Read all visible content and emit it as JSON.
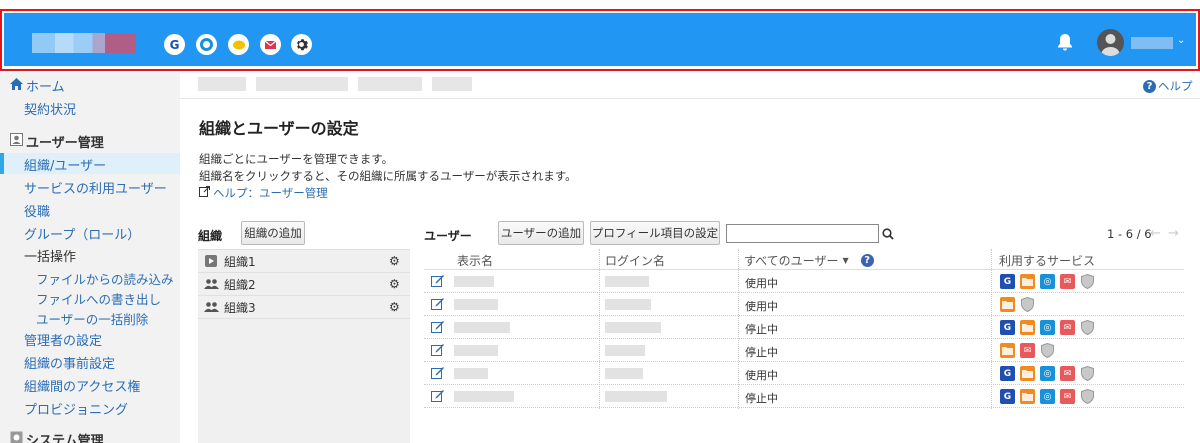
{
  "header": {
    "service_icons": [
      {
        "name": "g-service-icon",
        "glyph": "G",
        "color": "#1f4fb0"
      },
      {
        "name": "circle-service-icon",
        "glyph": "◎",
        "color": "#1891d9"
      },
      {
        "name": "chat-service-icon",
        "glyph": "●",
        "color": "#f2c200"
      },
      {
        "name": "mail-service-icon",
        "glyph": "✉",
        "color": "#e0364d"
      },
      {
        "name": "settings-gear-icon",
        "glyph": "⚙",
        "color": "#333333"
      }
    ],
    "caret": "⌄"
  },
  "sidebar": {
    "home": "ホーム",
    "contract": "契約状況",
    "user_mgmt": "ユーザー管理",
    "items": [
      "組織/ユーザー",
      "サービスの利用ユーザー",
      "役職",
      "グループ（ロール）"
    ],
    "bulk": "一括操作",
    "bulk_items": [
      "ファイルからの読み込み",
      "ファイルへの書き出し",
      "ユーザーの一括削除"
    ],
    "more": [
      "管理者の設定",
      "組織の事前設定",
      "組織間のアクセス権",
      "プロビジョニング"
    ],
    "system_mgmt": "システム管理"
  },
  "main": {
    "help": "ヘルプ",
    "title": "組織とユーザーの設定",
    "desc1": "組織ごとにユーザーを管理できます。",
    "desc2": "組織名をクリックすると、その組織に所属するユーザーが表示されます。",
    "help_link": "ヘルプ：ユーザー管理",
    "org_label": "組織",
    "add_org": "組織の追加",
    "orgs": [
      "組織1",
      "組織2",
      "組織3"
    ],
    "user_label": "ユーザー",
    "add_user": "ユーザーの追加",
    "profile_settings": "プロフィール項目の設定",
    "search_value": "",
    "pager": "1 - 6 / 6",
    "columns": {
      "display_name": "表示名",
      "login_name": "ログイン名",
      "all_users": "すべてのユーザー",
      "services": "利用するサービス"
    },
    "rows": [
      {
        "status": "使用中",
        "services": [
          "G",
          "F",
          "O",
          "M",
          "S"
        ]
      },
      {
        "status": "使用中",
        "services": [
          "F",
          "S"
        ]
      },
      {
        "status": "停止中",
        "services": [
          "G",
          "F",
          "O",
          "M",
          "S"
        ]
      },
      {
        "status": "停止中",
        "services": [
          "F",
          "M",
          "S"
        ]
      },
      {
        "status": "使用中",
        "services": [
          "G",
          "F",
          "O",
          "M",
          "S"
        ]
      },
      {
        "status": "停止中",
        "services": [
          "G",
          "F",
          "O",
          "M",
          "S"
        ]
      }
    ]
  }
}
